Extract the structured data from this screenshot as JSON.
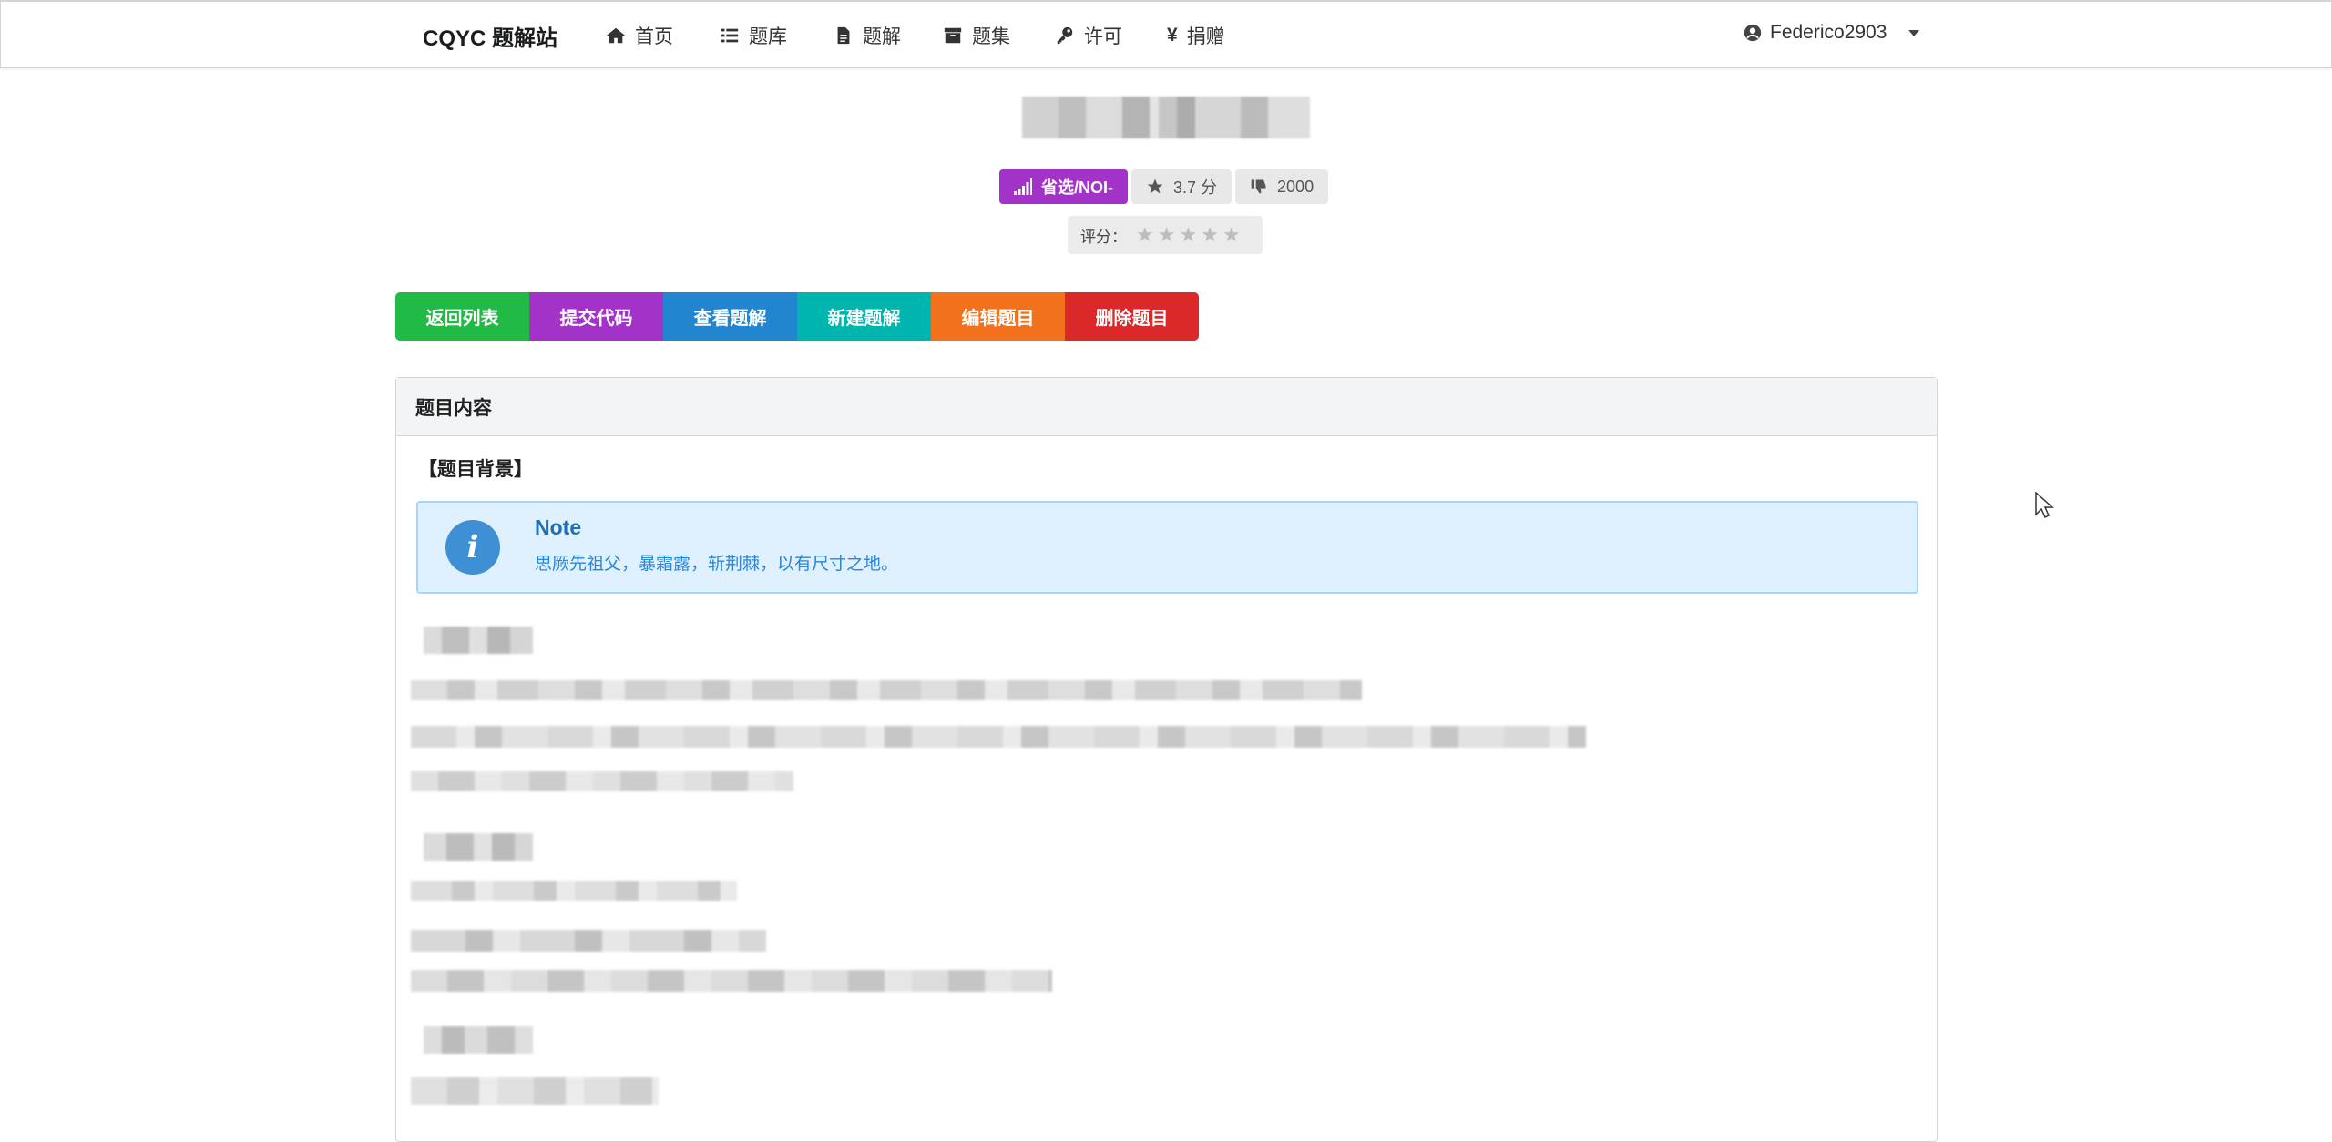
{
  "nav": {
    "brand": "CQYC 题解站",
    "items": [
      {
        "label": "首页",
        "icon": "home-icon"
      },
      {
        "label": "题库",
        "icon": "list-icon"
      },
      {
        "label": "题解",
        "icon": "file-icon"
      },
      {
        "label": "题集",
        "icon": "archive-icon"
      },
      {
        "label": "许可",
        "icon": "key-icon"
      },
      {
        "label": "捐赠",
        "icon": "yen-icon"
      }
    ],
    "user": "Federico2903"
  },
  "problem": {
    "difficulty": "省选/NOI-",
    "score": "3.7 分",
    "dislikes": "2000",
    "rating_label": "评分：",
    "rating_stars_max": 5,
    "rating_value": 0
  },
  "actions": [
    {
      "label": "返回列表",
      "color": "#21ba45"
    },
    {
      "label": "提交代码",
      "color": "#a333c8"
    },
    {
      "label": "查看题解",
      "color": "#2185d0"
    },
    {
      "label": "新建题解",
      "color": "#00b5ad"
    },
    {
      "label": "编辑题目",
      "color": "#f2711c"
    },
    {
      "label": "删除题目",
      "color": "#db2828"
    }
  ],
  "content": {
    "panel_title": "题目内容",
    "background_heading": "【题目背景】",
    "note_title": "Note",
    "note_text": "思厥先祖父，暴霜露，斩荆棘，以有尺寸之地。"
  }
}
